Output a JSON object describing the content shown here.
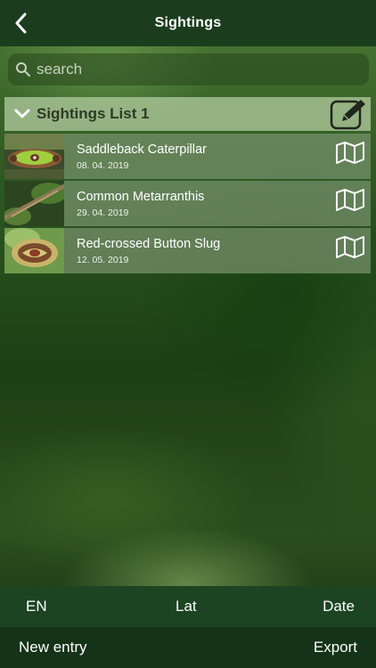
{
  "nav": {
    "title": "Sightings"
  },
  "search": {
    "placeholder": "search"
  },
  "list": {
    "title": "Sightings List 1",
    "items": [
      {
        "name": "Saddleback Caterpillar",
        "date": "08. 04. 2019"
      },
      {
        "name": "Common Metarranthis",
        "date": "29. 04. 2019"
      },
      {
        "name": "Red-crossed Button Slug",
        "date": "12. 05. 2019"
      }
    ]
  },
  "sort_bar": {
    "language": "EN",
    "latin": "Lat",
    "date": "Date"
  },
  "bottom_bar": {
    "new_entry": "New entry",
    "export": "Export"
  },
  "icons": {
    "back": "chevron-left-icon",
    "search": "search-icon",
    "collapse": "chevron-down-icon",
    "edit": "edit-icon",
    "map": "map-icon"
  },
  "colors": {
    "nav_bar": "#1b3d1e",
    "sort_bar": "#1c4423",
    "bottom_bar": "#153319",
    "list_header": "#aac396"
  }
}
